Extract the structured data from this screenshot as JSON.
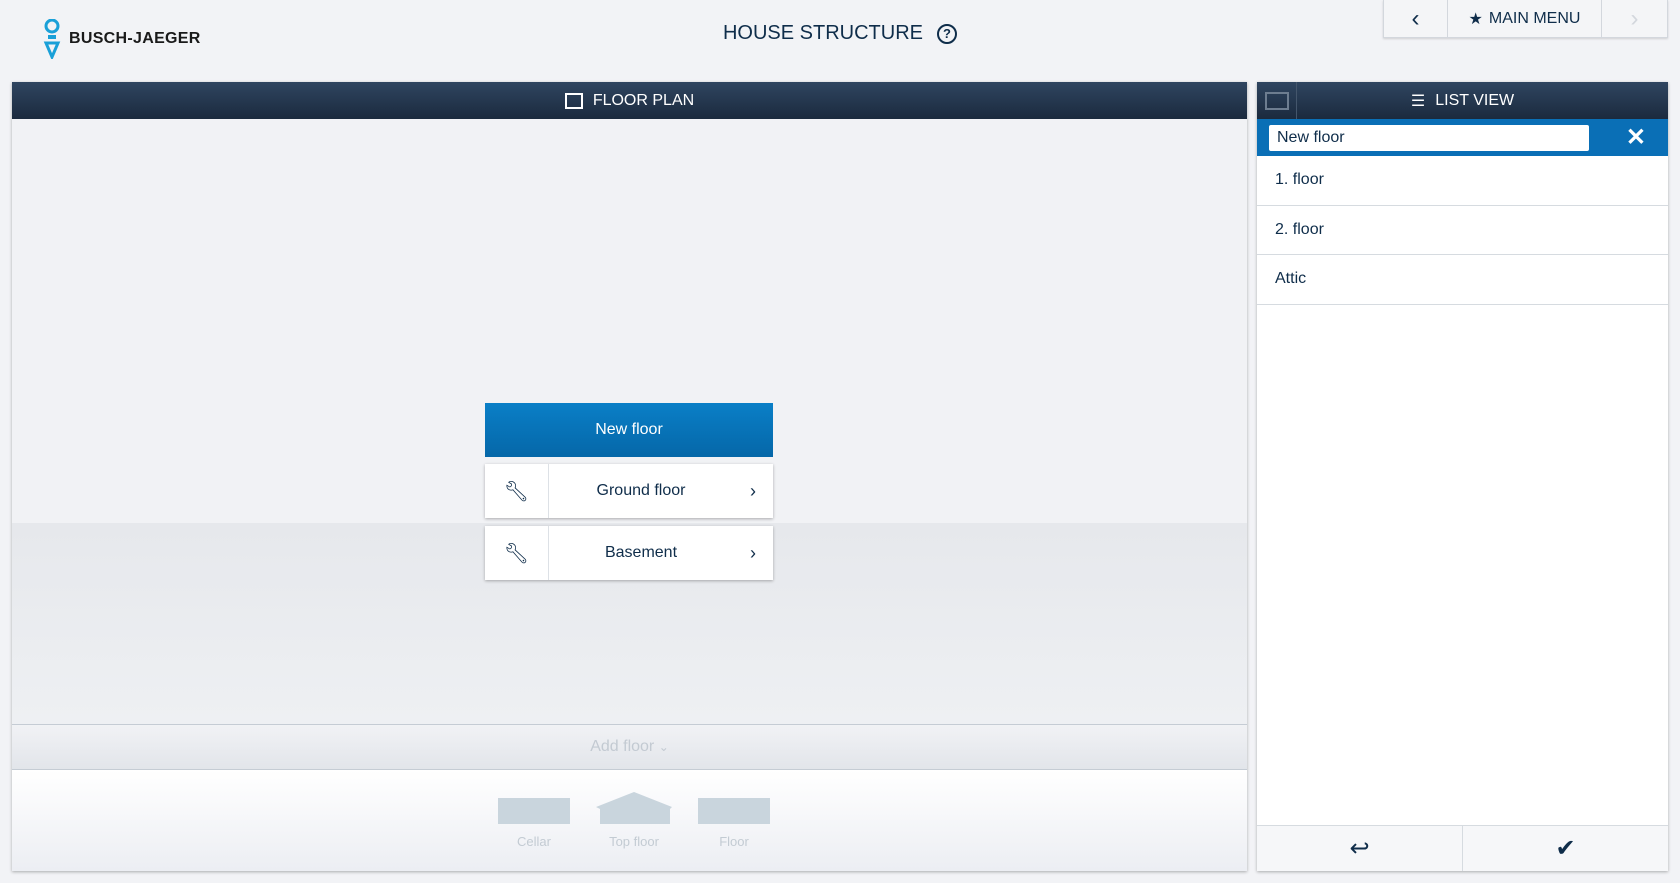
{
  "brand": "BUSCH-JAEGER",
  "header": {
    "title": "HOUSE STRUCTURE",
    "help": "?"
  },
  "topnav": {
    "back": "‹",
    "main_menu": "MAIN MENU",
    "forward": "›"
  },
  "floor_plan": {
    "title": "FLOOR PLAN",
    "new_floor": "New floor",
    "floors": [
      {
        "label": "Ground floor"
      },
      {
        "label": "Basement"
      }
    ],
    "add_floor": "Add floor",
    "templates": [
      {
        "label": "Cellar"
      },
      {
        "label": "Top floor"
      },
      {
        "label": "Floor"
      }
    ]
  },
  "list_view": {
    "title": "LIST VIEW",
    "input_value": "New floor",
    "items": [
      {
        "label": "1. floor"
      },
      {
        "label": "2. floor"
      },
      {
        "label": "Attic"
      }
    ]
  },
  "colors": {
    "accent": "#0a6fb6",
    "header": "#1b2a3e"
  }
}
